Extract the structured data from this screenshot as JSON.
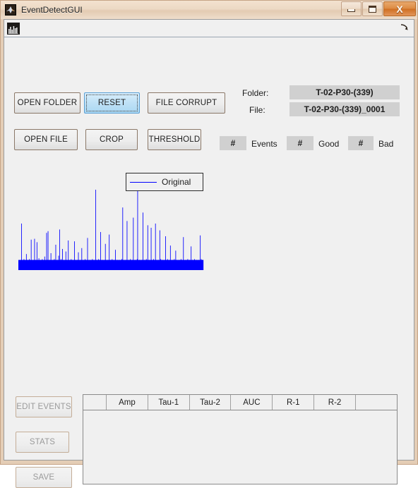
{
  "window": {
    "title": "EventDetectGUI",
    "app_icon": "matlab-icon",
    "controls": {
      "minimize": "minimize-icon",
      "maximize": "maximize-icon",
      "close": "X"
    }
  },
  "toolbar": {
    "chart_icon": "histogram-icon",
    "overflow_icon": "arrow-down-right-icon"
  },
  "buttons": {
    "open_folder": "OPEN FOLDER",
    "reset": "RESET",
    "file_corrupt": "FILE CORRUPT",
    "open_file": "OPEN FILE",
    "crop": "CROP",
    "threshold": "THRESHOLD",
    "edit_events": "EDIT EVENTS",
    "stats": "STATS",
    "save": "SAVE"
  },
  "fileinfo": {
    "folder_label": "Folder:",
    "folder_value": "T-02-P30-(339)",
    "file_label": "File:",
    "file_value": "T-02-P30-(339)_0001"
  },
  "counters": [
    {
      "value": "#",
      "label": "Events"
    },
    {
      "value": "#",
      "label": "Good"
    },
    {
      "value": "#",
      "label": "Bad"
    }
  ],
  "table": {
    "headers": [
      "",
      "Amp",
      "Tau-1",
      "Tau-2",
      "AUC",
      "R-1",
      "R-2",
      ""
    ],
    "rows": []
  },
  "chart_data": {
    "type": "line",
    "title": "",
    "xlabel": "",
    "ylabel": "",
    "legend": [
      "Original"
    ],
    "legend_position": "top-center",
    "grid": false,
    "series_color": "#0000ff",
    "baseline": 0.12,
    "ylim": [
      0,
      1
    ],
    "xlim": [
      0,
      600
    ],
    "values": [
      0.1,
      0.09,
      0.11,
      0.1,
      0.12,
      0.09,
      0.55,
      0.12,
      0.1,
      0.09,
      0.11,
      0.13,
      0.1,
      0.09,
      0.11,
      0.1,
      0.19,
      0.1,
      0.12,
      0.09,
      0.11,
      0.1,
      0.13,
      0.09,
      0.1,
      0.12,
      0.36,
      0.11,
      0.1,
      0.09,
      0.12,
      0.1,
      0.11,
      0.37,
      0.1,
      0.12,
      0.09,
      0.1,
      0.33,
      0.11,
      0.1,
      0.09,
      0.14,
      0.11,
      0.1,
      0.12,
      0.09,
      0.11,
      0.1,
      0.13,
      0.09,
      0.11,
      0.1,
      0.12,
      0.16,
      0.09,
      0.1,
      0.11,
      0.44,
      0.1,
      0.12,
      0.46,
      0.09,
      0.11,
      0.1,
      0.12,
      0.09,
      0.2,
      0.11,
      0.1,
      0.09,
      0.12,
      0.1,
      0.11,
      0.13,
      0.09,
      0.1,
      0.3,
      0.11,
      0.1,
      0.09,
      0.12,
      0.1,
      0.17,
      0.11,
      0.48,
      0.1,
      0.09,
      0.13,
      0.11,
      0.1,
      0.25,
      0.09,
      0.12,
      0.1,
      0.11,
      0.09,
      0.1,
      0.22,
      0.12,
      0.1,
      0.09,
      0.11,
      0.35,
      0.1,
      0.12,
      0.09,
      0.1,
      0.11,
      0.13,
      0.09,
      0.1,
      0.12,
      0.11,
      0.09,
      0.1,
      0.34,
      0.12,
      0.1,
      0.09,
      0.11,
      0.1,
      0.12,
      0.09,
      0.21,
      0.11,
      0.1,
      0.09,
      0.12,
      0.1,
      0.11,
      0.26,
      0.09,
      0.1,
      0.12,
      0.11,
      0.09,
      0.1,
      0.13,
      0.11,
      0.1,
      0.09,
      0.12,
      0.38,
      0.1,
      0.11,
      0.09,
      0.1,
      0.12,
      0.11,
      0.09,
      0.1,
      0.11,
      0.13,
      0.1,
      0.09,
      0.12,
      0.1,
      0.11,
      0.09,
      0.95,
      0.1,
      0.12,
      0.09,
      0.11,
      0.1,
      0.13,
      0.09,
      0.1,
      0.12,
      0.45,
      0.11,
      0.1,
      0.09,
      0.12,
      0.1,
      0.11,
      0.09,
      0.1,
      0.12,
      0.31,
      0.1,
      0.11,
      0.09,
      0.1,
      0.12,
      0.11,
      0.09,
      0.42,
      0.1,
      0.12,
      0.09,
      0.11,
      0.1,
      0.13,
      0.09,
      0.1,
      0.11,
      0.12,
      0.09,
      0.1,
      0.24,
      0.11,
      0.1,
      0.09,
      0.12,
      0.1,
      0.11,
      0.09,
      0.1,
      0.12,
      0.11,
      0.09,
      0.1,
      0.13,
      0.11,
      0.74,
      0.09,
      0.12,
      0.1,
      0.11,
      0.09,
      0.1,
      0.12,
      0.11,
      0.58,
      0.09,
      0.1,
      0.12,
      0.11,
      0.09,
      0.1,
      0.13,
      0.11,
      0.1,
      0.09,
      0.12,
      0.1,
      0.62,
      0.11,
      0.09,
      0.1,
      0.12,
      0.11,
      0.09,
      0.1,
      0.13,
      1.0,
      0.11,
      0.1,
      0.09,
      0.12,
      0.1,
      0.11,
      0.09,
      0.1,
      0.12,
      0.11,
      0.68,
      0.09,
      0.1,
      0.12,
      0.11,
      0.09,
      0.1,
      0.13,
      0.11,
      0.1,
      0.53,
      0.09,
      0.12,
      0.1,
      0.11,
      0.09,
      0.1,
      0.5,
      0.12,
      0.11,
      0.09,
      0.1,
      0.13,
      0.11,
      0.1,
      0.09,
      0.55,
      0.12,
      0.1,
      0.11,
      0.09,
      0.1,
      0.12,
      0.11,
      0.09,
      0.47,
      0.1,
      0.13,
      0.11,
      0.1,
      0.09,
      0.12,
      0.1,
      0.11,
      0.09,
      0.1,
      0.12,
      0.4,
      0.11,
      0.09,
      0.1,
      0.13,
      0.11,
      0.1,
      0.09,
      0.12,
      0.1,
      0.29,
      0.11,
      0.09,
      0.1,
      0.12,
      0.11,
      0.09,
      0.1,
      0.13,
      0.11,
      0.1,
      0.23,
      0.09,
      0.12,
      0.1,
      0.11,
      0.09,
      0.1,
      0.12,
      0.11,
      0.09,
      0.1,
      0.13,
      0.11,
      0.1,
      0.09,
      0.12,
      0.39,
      0.1,
      0.11,
      0.09,
      0.1,
      0.12,
      0.11,
      0.09,
      0.1,
      0.13,
      0.11,
      0.1,
      0.09,
      0.12,
      0.1,
      0.11,
      0.28,
      0.09,
      0.1,
      0.12,
      0.11,
      0.09,
      0.1,
      0.13,
      0.11,
      0.1,
      0.09,
      0.12,
      0.1,
      0.11,
      0.09,
      0.1,
      0.12,
      0.11,
      0.09,
      0.41,
      0.1,
      0.13,
      0.11,
      0.1,
      0.09,
      0.12
    ]
  }
}
